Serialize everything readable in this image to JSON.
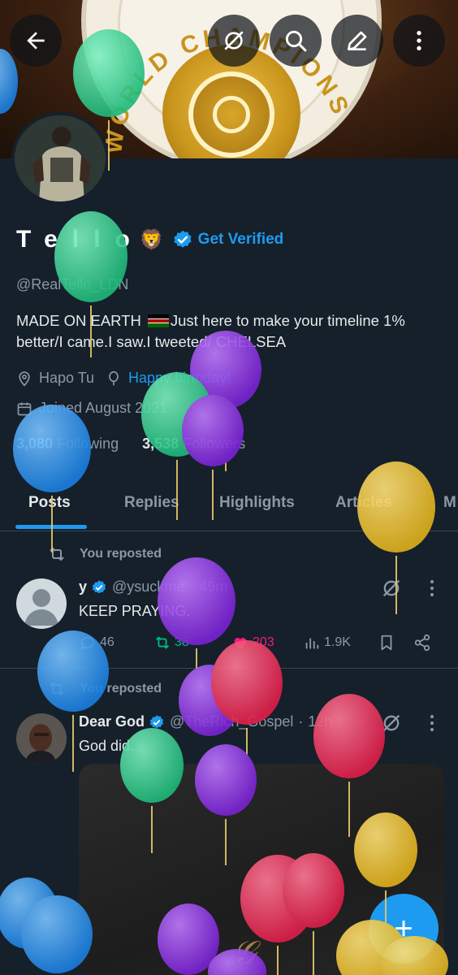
{
  "header": {
    "banner_text": "WORLD CHAMPIONS",
    "back_icon": "arrow-left-icon",
    "grok_icon": "grok-icon",
    "search_icon": "search-icon",
    "edit_icon": "pencil-icon",
    "more_icon": "more-vertical-icon"
  },
  "profile": {
    "name": "Tello",
    "emoji": "🦁",
    "get_verified": "Get Verified",
    "handle": "@RealTello_LDN",
    "bio_part1": "MADE ON EARTH",
    "bio_part2": "Just here to make your timeline 1%",
    "bio_line2": "better/I came.I saw.I tweeted/ CHELSEA",
    "location": "Hapo Tu",
    "birthday": "Happy birthday!",
    "joined": "Joined August 2021",
    "following_count": "3,080",
    "following_label": "Following",
    "followers_count": "3,538",
    "followers_label": "Followers"
  },
  "tabs": [
    {
      "label": "Posts",
      "active": true
    },
    {
      "label": "Replies"
    },
    {
      "label": "Highlights"
    },
    {
      "label": "Articles"
    },
    {
      "label": "M"
    }
  ],
  "posts": [
    {
      "repost_label": "You reposted",
      "name": "y",
      "handle": "@ysuckme",
      "time": "49m",
      "text": "KEEP PRAYING.",
      "replies": "46",
      "reposts": "38",
      "likes": "203",
      "views": "1.9K"
    },
    {
      "repost_label": "You reposted",
      "name": "Dear God",
      "handle": "@TheRich_Gospel",
      "time": "12h",
      "text": "God did."
    }
  ],
  "fab_label": "+",
  "colors": {
    "background": "#15202b",
    "accent": "#1d9bf0",
    "repost_green": "#00ba7c",
    "like_pink": "#f91880",
    "muted": "#8b98a5"
  }
}
